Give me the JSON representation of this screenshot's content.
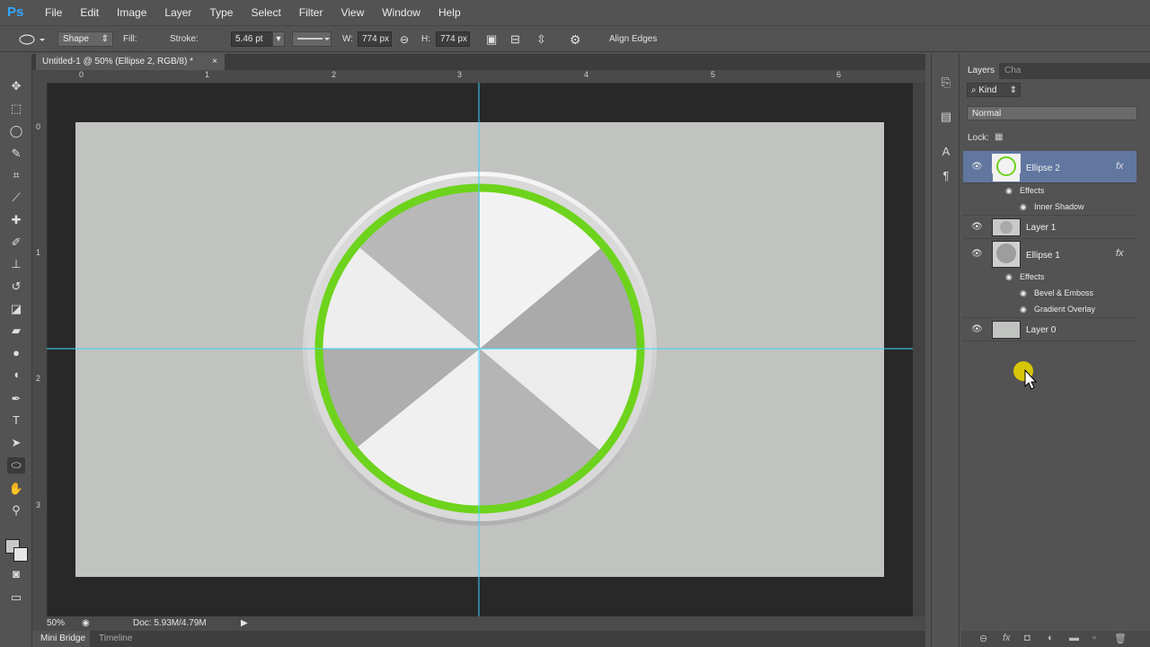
{
  "app": {
    "logo": "Ps"
  },
  "menu": [
    "File",
    "Edit",
    "Image",
    "Layer",
    "Type",
    "Select",
    "Filter",
    "View",
    "Window",
    "Help"
  ],
  "options": {
    "shape_mode": "Shape",
    "fill_label": "Fill:",
    "stroke_label": "Stroke:",
    "stroke_color": "#6ed31c",
    "stroke_width": "5.46 pt",
    "w_label": "W:",
    "w_value": "774 px",
    "h_label": "H:",
    "h_value": "774 px",
    "align_edges": "Align Edges"
  },
  "document": {
    "tab_title": "Untitled-1 @ 50% (Ellipse 2, RGB/8) *",
    "ruler_top": [
      "0",
      "1",
      "2",
      "3",
      "4",
      "5",
      "6"
    ],
    "ruler_left": [
      "0",
      "1",
      "2",
      "3"
    ]
  },
  "status": {
    "zoom": "50%",
    "doc": "Doc: 5.93M/4.79M"
  },
  "bottom_tabs": [
    "Mini Bridge",
    "Timeline"
  ],
  "layers_panel": {
    "tabs": [
      "Layers",
      "Cha"
    ],
    "filter_kind": "Kind",
    "blend_mode": "Normal",
    "lock_label": "Lock:",
    "layers": [
      {
        "name": "Ellipse 2",
        "fx": "fx",
        "effects_label": "Effects",
        "effects": [
          "Inner Shadow"
        ]
      },
      {
        "name": "Layer 1"
      },
      {
        "name": "Ellipse 1",
        "fx": "fx",
        "effects_label": "Effects",
        "effects": [
          "Bevel & Emboss",
          "Gradient Overlay"
        ]
      },
      {
        "name": "Layer 0"
      }
    ]
  },
  "colors": {
    "guide": "#38d6ff",
    "stroke_ring": "#6ed31c",
    "canvas_bg": "#c1c3c0",
    "selected_layer": "#6177a0"
  }
}
